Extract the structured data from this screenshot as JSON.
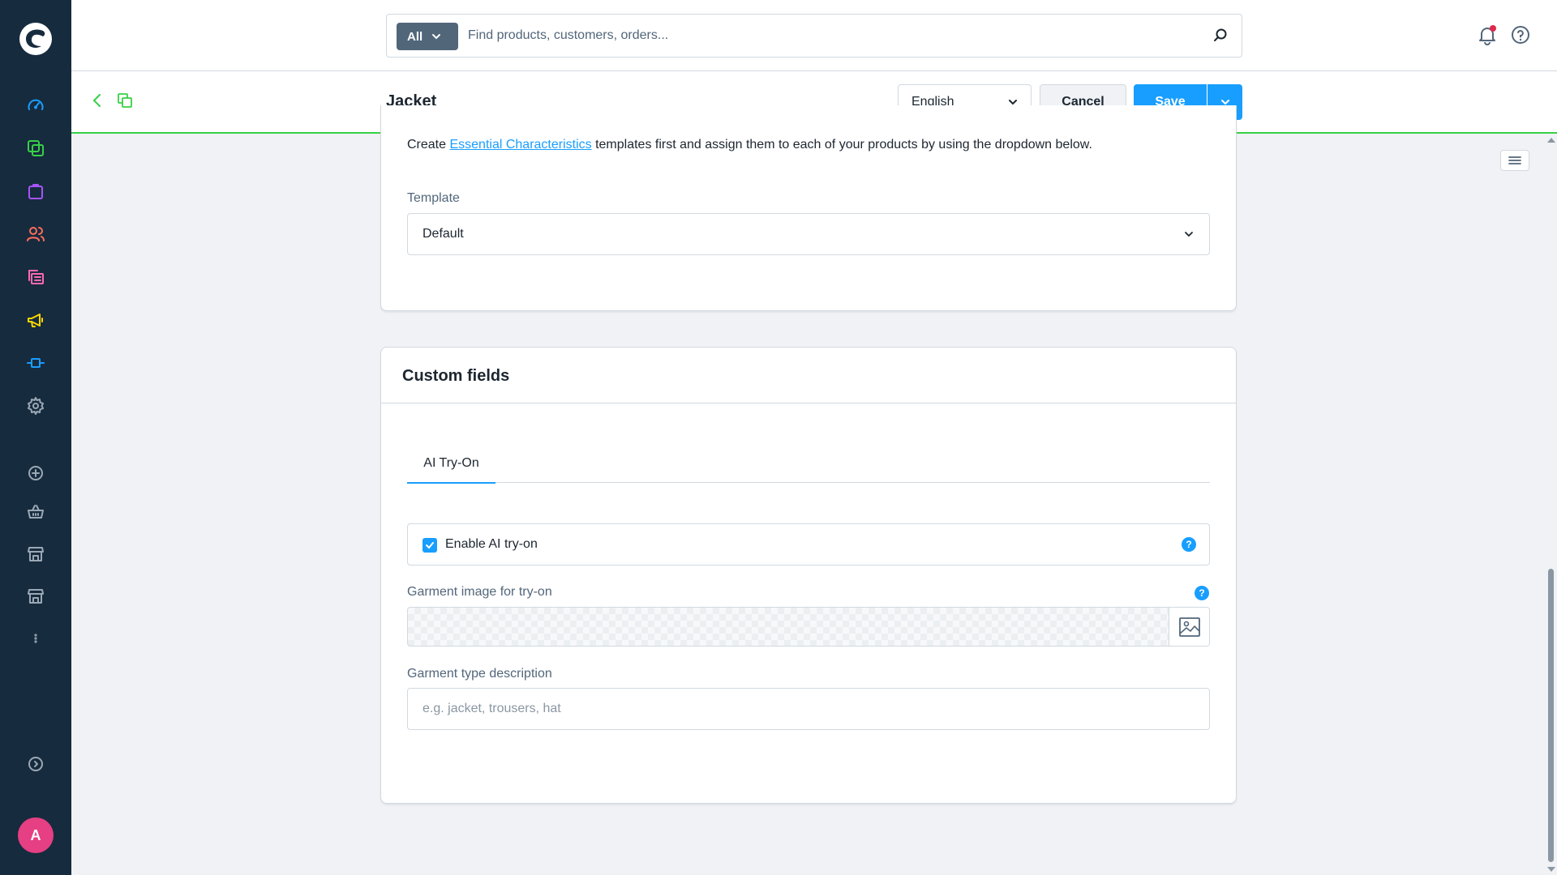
{
  "colors": {
    "sidebar_bg": "#172b3e",
    "accent": "#189eff",
    "avatar_bg": "#e63f83",
    "header_border": "#37d046"
  },
  "sidebar": {
    "items": [
      {
        "icon": "gauge-icon",
        "label": "Dashboard",
        "color": "#189eff"
      },
      {
        "icon": "layers-icon",
        "label": "Catalogues",
        "color": "#37d046"
      },
      {
        "icon": "bag-icon",
        "label": "Orders",
        "color": "#a555f7"
      },
      {
        "icon": "users-icon",
        "label": "Customers",
        "color": "#ff6d5c"
      },
      {
        "icon": "content-icon",
        "label": "Content",
        "color": "#ff68b4"
      },
      {
        "icon": "megaphone-icon",
        "label": "Marketing",
        "color": "#ffd700"
      },
      {
        "icon": "plugin-icon",
        "label": "Extensions",
        "color": "#189eff"
      },
      {
        "icon": "gear-icon",
        "label": "Settings",
        "color": "#9aa8b5"
      },
      {
        "icon": "plus-circle-icon",
        "label": "Add",
        "color": "#9aa8b5"
      },
      {
        "icon": "basket-icon",
        "label": "Sales channel",
        "color": "#9aa8b5"
      },
      {
        "icon": "storefront-icon",
        "label": "Storefront",
        "color": "#9aa8b5"
      },
      {
        "icon": "storefront-icon",
        "label": "Storefront 2",
        "color": "#9aa8b5"
      },
      {
        "icon": "more-vertical-icon",
        "label": "More",
        "color": "#9aa8b5"
      },
      {
        "icon": "chevron-circle-right-icon",
        "label": "Expand",
        "color": "#9aa8b5"
      }
    ],
    "avatar_initial": "A"
  },
  "search": {
    "type_label": "All",
    "placeholder": "Find products, customers, orders..."
  },
  "smartbar": {
    "title": "Jacket",
    "language": "English",
    "cancel_label": "Cancel",
    "save_label": "Save"
  },
  "essential_characteristics": {
    "help_prefix": "Create ",
    "help_link": "Essential Characteristics",
    "help_suffix": " templates first and assign them to each of your products by using the dropdown below.",
    "template_label": "Template",
    "template_value": "Default"
  },
  "custom_fields": {
    "title": "Custom fields",
    "tabs": [
      {
        "label": "AI Try-On"
      }
    ],
    "enable_label": "Enable AI try-on",
    "enable_checked": true,
    "garment_image_label": "Garment image for try-on",
    "garment_type_label": "Garment type description",
    "garment_type_placeholder": "e.g. jacket, trousers, hat",
    "help_glyph": "?"
  }
}
